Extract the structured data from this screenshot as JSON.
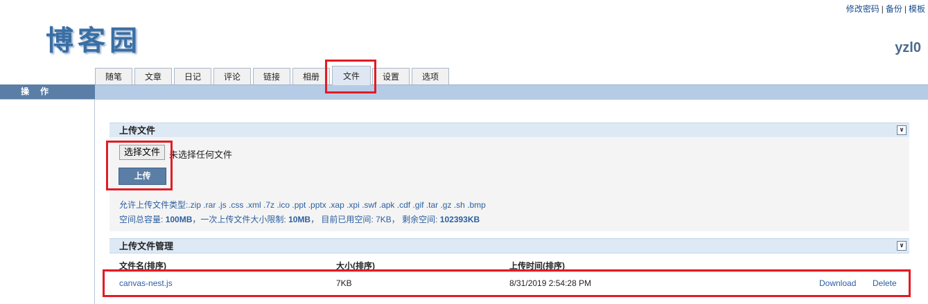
{
  "header": {
    "top_links": [
      "修改密码",
      "备份",
      "模板"
    ],
    "logo_text": "博客园",
    "username": "yzl0"
  },
  "tabs": [
    {
      "label": "随笔"
    },
    {
      "label": "文章"
    },
    {
      "label": "日记"
    },
    {
      "label": "评论"
    },
    {
      "label": "链接"
    },
    {
      "label": "相册"
    },
    {
      "label": "文件",
      "active": true
    },
    {
      "label": "设置"
    },
    {
      "label": "选项"
    }
  ],
  "sidebar": {
    "heading": "操作"
  },
  "upload_panel": {
    "title": "上传文件",
    "choose_button": "选择文件",
    "no_file_text": "未选择任何文件",
    "upload_button": "上传",
    "allowed_types": "允许上传文件类型:.zip .rar .js .css .xml .7z .ico .ppt .pptx .xap .xpi .swf .apk .cdf .gif .tar .gz .sh .bmp",
    "space": {
      "total_label": "空间总容量:",
      "total_value": "100MB",
      "single_label": "，一次上传文件大小限制:",
      "single_value": "10MB",
      "used_label": "， 目前已用空间:",
      "used_value": "7KB",
      "remaining_label": "， 剩余空间:",
      "remaining_value": "102393KB"
    }
  },
  "manage_panel": {
    "title": "上传文件管理",
    "columns": [
      "文件名(排序)",
      "大小(排序)",
      "上传时间(排序)"
    ],
    "rows": [
      {
        "name": "canvas-nest.js",
        "size": "7KB",
        "time": "8/31/2019 2:54:28 PM",
        "download": "Download",
        "delete": "Delete"
      }
    ]
  },
  "colors": {
    "accent": "#5b7ea6",
    "tab_bar": "#b6cce6",
    "highlight": "#e21b23",
    "link": "#2b5fa0"
  }
}
